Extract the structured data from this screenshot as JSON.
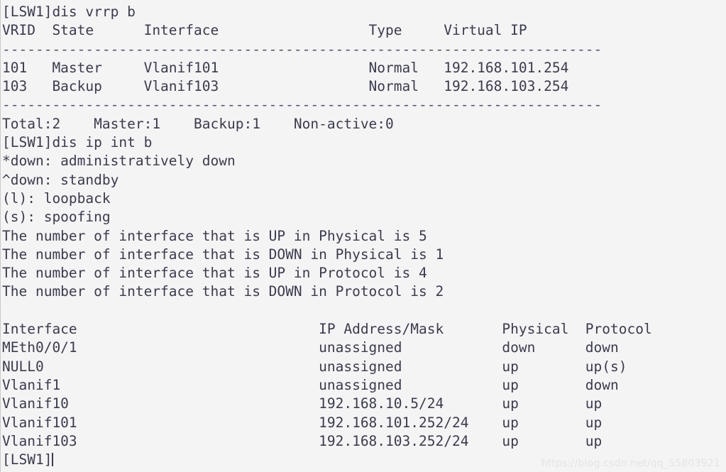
{
  "terminal": {
    "background_color": "#f4f4f4",
    "text_color": "#3b3b4f",
    "separator_color": "#55556a",
    "prompt": "[LSW1]",
    "watermark": "https://blog.csdn.net/qq_55803921",
    "separator_char": "-",
    "separator_length": 72
  },
  "commands": [
    {
      "prompt": "[LSW1]",
      "command": "dis vrrp b"
    },
    {
      "prompt": "[LSW1]",
      "command": "dis ip int b"
    }
  ],
  "vrrp": {
    "command_line": "[LSW1]dis vrrp b",
    "columns": [
      "VRID",
      "State",
      "Interface",
      "Type",
      "Virtual IP"
    ],
    "header_line": "VRID  State      Interface                  Type     Virtual IP",
    "rows": [
      {
        "vrid": "101",
        "state": "Master",
        "interface": "Vlanif101",
        "type": "Normal",
        "virtual_ip": "192.168.101.254"
      },
      {
        "vrid": "103",
        "state": "Backup",
        "interface": "Vlanif103",
        "type": "Normal",
        "virtual_ip": "192.168.103.254"
      }
    ],
    "row_lines": [
      "101   Master     Vlanif101                  Normal   192.168.101.254",
      "103   Backup     Vlanif103                  Normal   192.168.103.254"
    ],
    "summary": {
      "total_label": "Total:2",
      "master_label": "Master:1",
      "backup_label": "Backup:1",
      "non_active_label": "Non-active:0",
      "line": "Total:2    Master:1    Backup:1    Non-active:0"
    }
  },
  "ip_interface": {
    "command_line": "[LSW1]dis ip int b",
    "legend": [
      "*down: administratively down",
      "^down: standby",
      "(l): loopback",
      "(s): spoofing"
    ],
    "counters": [
      "The number of interface that is UP in Physical is 5",
      "The number of interface that is DOWN in Physical is 1",
      "The number of interface that is UP in Protocol is 4",
      "The number of interface that is DOWN in Protocol is 2"
    ],
    "counter_values": {
      "up_physical": 5,
      "down_physical": 1,
      "up_protocol": 4,
      "down_protocol": 2
    },
    "columns": [
      "Interface",
      "IP Address/Mask",
      "Physical",
      "Protocol"
    ],
    "header_line": "Interface                             IP Address/Mask       Physical  Protocol",
    "rows": [
      {
        "interface": "MEth0/0/1",
        "ip": "unassigned",
        "physical": "down",
        "protocol": "down"
      },
      {
        "interface": "NULL0",
        "ip": "unassigned",
        "physical": "up",
        "protocol": "up(s)"
      },
      {
        "interface": "Vlanif1",
        "ip": "unassigned",
        "physical": "up",
        "protocol": "down"
      },
      {
        "interface": "Vlanif10",
        "ip": "192.168.10.5/24",
        "physical": "up",
        "protocol": "up"
      },
      {
        "interface": "Vlanif101",
        "ip": "192.168.101.252/24",
        "physical": "up",
        "protocol": "up"
      },
      {
        "interface": "Vlanif103",
        "ip": "192.168.103.252/24",
        "physical": "up",
        "protocol": "up"
      }
    ],
    "row_lines": [
      "MEth0/0/1                             unassigned            down      down",
      "NULL0                                 unassigned            up        up(s)",
      "Vlanif1                               unassigned            up        down",
      "Vlanif10                              192.168.10.5/24       up        up",
      "Vlanif101                             192.168.101.252/24    up        up",
      "Vlanif103                             192.168.103.252/24    up        up"
    ]
  },
  "final_prompt": "[LSW1]",
  "lines": {
    "l00": "[LSW1]dis vrrp b",
    "l01": "VRID  State      Interface                  Type     Virtual IP",
    "l02": "------------------------------------------------------------------------",
    "l03": "101   Master     Vlanif101                  Normal   192.168.101.254",
    "l04": "103   Backup     Vlanif103                  Normal   192.168.103.254",
    "l05": "------------------------------------------------------------------------",
    "l06": "Total:2    Master:1    Backup:1    Non-active:0",
    "l07": "[LSW1]dis ip int b",
    "l08": "*down: administratively down",
    "l09": "^down: standby",
    "l10": "(l): loopback",
    "l11": "(s): spoofing",
    "l12": "The number of interface that is UP in Physical is 5",
    "l13": "The number of interface that is DOWN in Physical is 1",
    "l14": "The number of interface that is UP in Protocol is 4",
    "l15": "The number of interface that is DOWN in Protocol is 2",
    "l16": " ",
    "l17": "Interface                             IP Address/Mask       Physical  Protocol",
    "l18": "MEth0/0/1                             unassigned            down      down",
    "l19": "NULL0                                 unassigned            up        up(s)",
    "l20": "Vlanif1                               unassigned            up        down",
    "l21": "Vlanif10                              192.168.10.5/24       up        up",
    "l22": "Vlanif101                             192.168.101.252/24    up        up",
    "l23": "Vlanif103                             192.168.103.252/24    up        up",
    "l24": "[LSW1]"
  }
}
